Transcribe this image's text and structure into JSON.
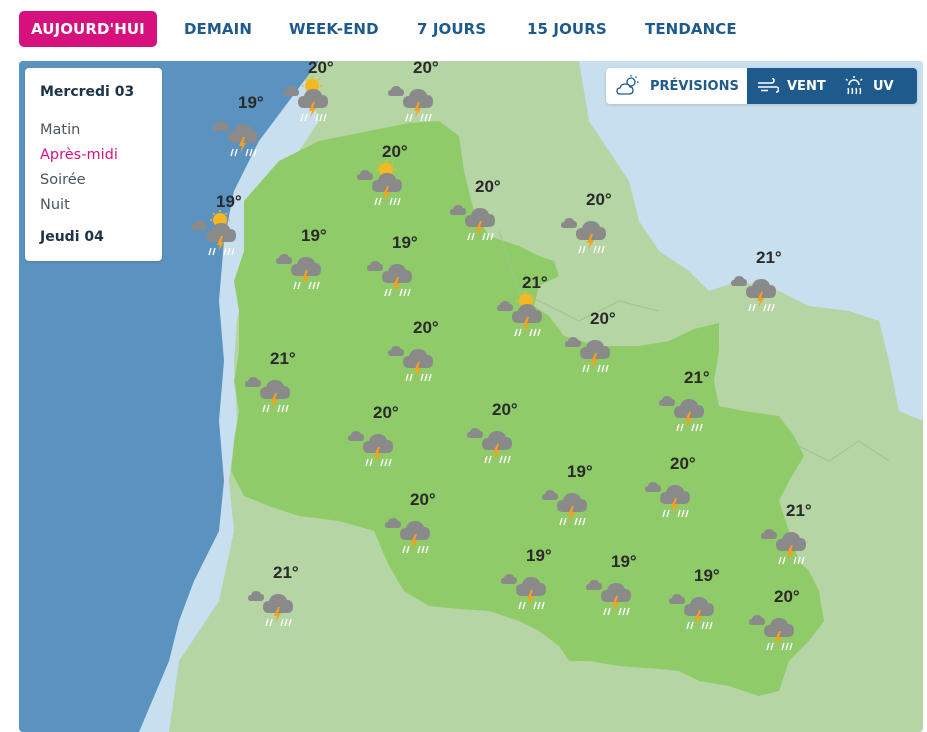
{
  "tabs": [
    {
      "label": "AUJOURD'HUI",
      "active": true
    },
    {
      "label": "DEMAIN",
      "active": false
    },
    {
      "label": "WEEK-END",
      "active": false
    },
    {
      "label": "7 JOURS",
      "active": false
    },
    {
      "label": "15 JOURS",
      "active": false
    },
    {
      "label": "TENDANCE",
      "active": false
    }
  ],
  "menu": {
    "day1": "Mercredi 03",
    "periods": [
      "Matin",
      "Après-midi",
      "Soirée",
      "Nuit"
    ],
    "active_period": "Après-midi",
    "day2": "Jeudi 04"
  },
  "layers": {
    "previsions": {
      "label": "PRÉVISIONS",
      "icon": "cloud-sun-icon"
    },
    "vent": {
      "label": "VENT",
      "icon": "wind-icon"
    },
    "uv": {
      "label": "UV",
      "icon": "uv-sun-icon"
    }
  },
  "colors": {
    "accent": "#d6117e",
    "nav_blue": "#1e5a8c",
    "sea": "#c8dfef",
    "land_neighbour": "#b5d5a5",
    "region": "#8fcc69"
  },
  "forecasts": [
    {
      "temp": "20°",
      "sun": true
    },
    {
      "temp": "20°",
      "sun": false
    },
    {
      "temp": "19°",
      "sun": false
    },
    {
      "temp": "20°",
      "sun": true
    },
    {
      "temp": "19°",
      "sun": true
    },
    {
      "temp": "20°",
      "sun": false
    },
    {
      "temp": "20°",
      "sun": false
    },
    {
      "temp": "19°",
      "sun": false
    },
    {
      "temp": "19°",
      "sun": false
    },
    {
      "temp": "21°",
      "sun": false
    },
    {
      "temp": "21°",
      "sun": true
    },
    {
      "temp": "20°",
      "sun": false
    },
    {
      "temp": "21°",
      "sun": false
    },
    {
      "temp": "20°",
      "sun": false
    },
    {
      "temp": "21°",
      "sun": false
    },
    {
      "temp": "20°",
      "sun": false
    },
    {
      "temp": "20°",
      "sun": false
    },
    {
      "temp": "19°",
      "sun": false
    },
    {
      "temp": "20°",
      "sun": false
    },
    {
      "temp": "20°",
      "sun": false
    },
    {
      "temp": "21°",
      "sun": false
    },
    {
      "temp": "21°",
      "sun": false
    },
    {
      "temp": "19°",
      "sun": false
    },
    {
      "temp": "19°",
      "sun": false
    },
    {
      "temp": "19°",
      "sun": false
    },
    {
      "temp": "20°",
      "sun": false
    }
  ]
}
